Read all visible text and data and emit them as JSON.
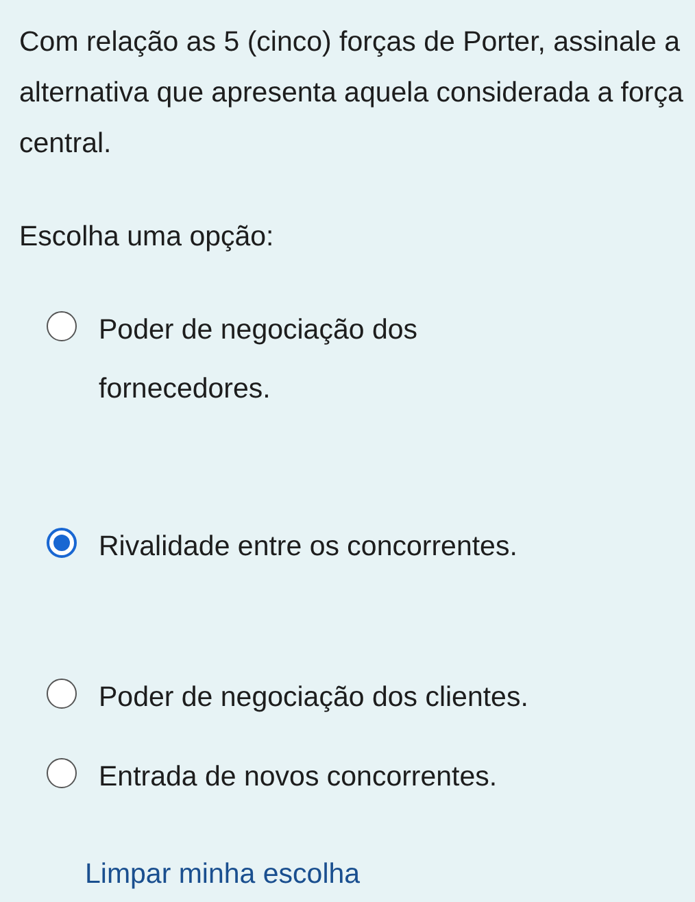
{
  "question": "Com relação as 5 (cinco) forças de Porter, assinale a alternativa que apresenta aquela considerada a força central.",
  "prompt": "Escolha uma opção:",
  "options": [
    {
      "label": "Poder de negociação dos fornecedores.",
      "selected": false
    },
    {
      "label": "Rivalidade entre os concorrentes.",
      "selected": true
    },
    {
      "label": "Poder de negociação dos clientes.",
      "selected": false
    },
    {
      "label": "Entrada de novos concorrentes.",
      "selected": false
    }
  ],
  "clear_link": "Limpar minha escolha"
}
